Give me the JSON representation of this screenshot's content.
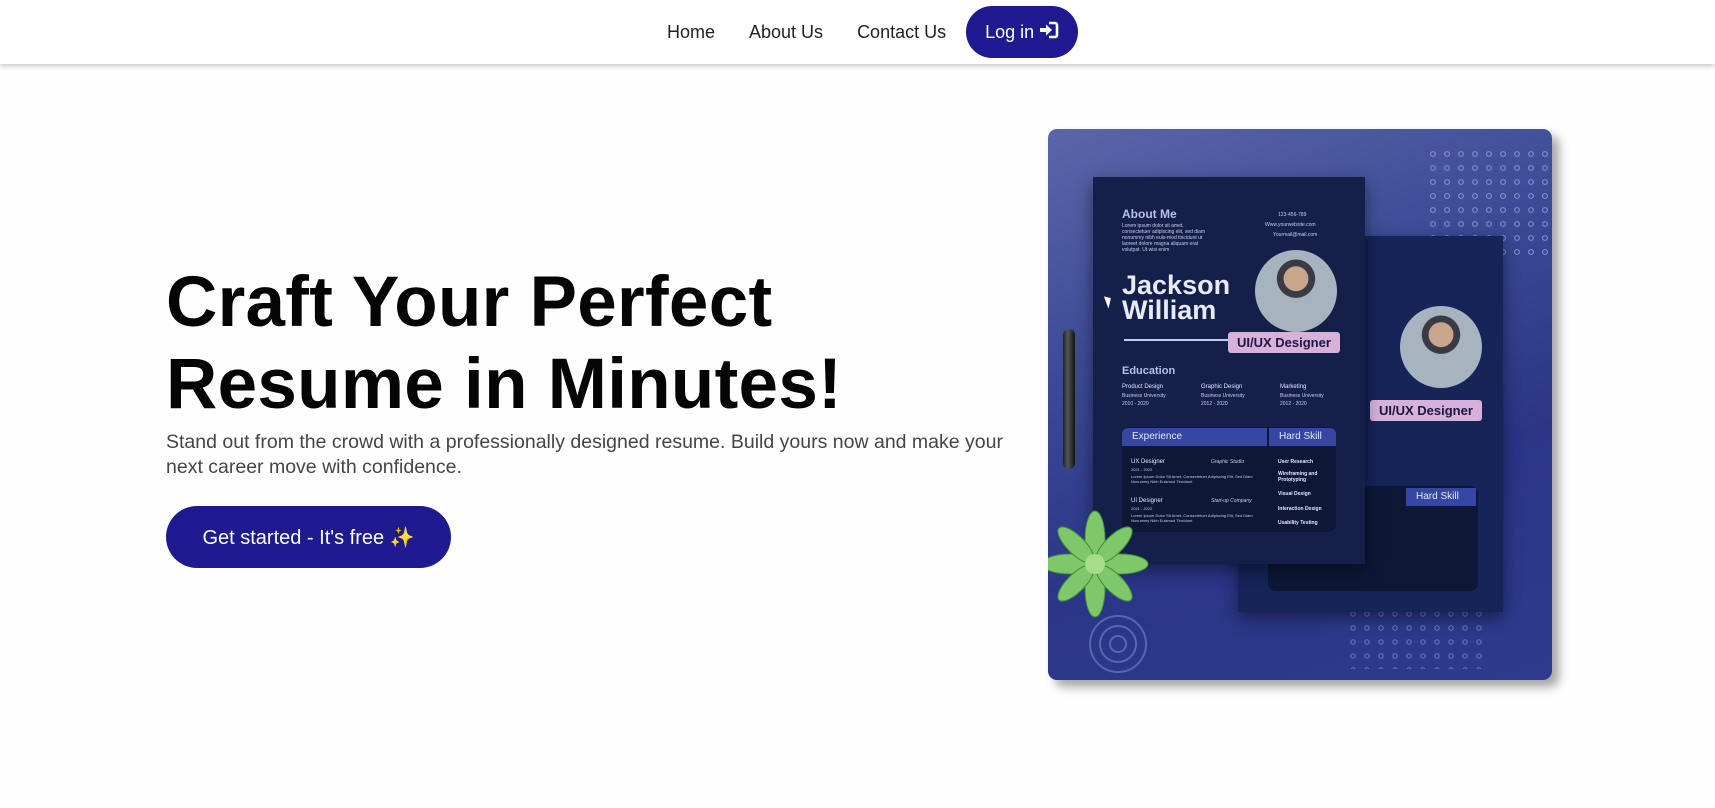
{
  "nav": {
    "items": [
      "Home",
      "About Us",
      "Contact Us"
    ],
    "login_label": "Log in",
    "login_icon": "sign-in-icon"
  },
  "hero": {
    "title": "Craft Your Perfect Resume in Minutes!",
    "subtitle": "Stand out from the crowd with a professionally designed resume. Build yours now and make your next career move with confidence.",
    "cta_label": "Get started - It's free ✨"
  },
  "resume_image": {
    "about_heading": "About Me",
    "about_text": "Lorem ipsum dolor sit amet, consectetuer adipiscing elit, sed diam nonummy nibh euis-mod tincidunt ut laoreet dolore magna aliquam erat volutpat. Ut wisi enim",
    "contact": [
      "123-456-789",
      "Www.yourwebsite.com",
      "Yourmail@mail.com"
    ],
    "first_name": "Jackson",
    "last_name": "William",
    "role": "UI/UX Designer",
    "education_heading": "Education",
    "education": [
      {
        "field": "Product Design",
        "school": "Business University",
        "years": "2010 - 2020"
      },
      {
        "field": "Graphic Design",
        "school": "Business University",
        "years": "2012 - 2020"
      },
      {
        "field": "Marketing",
        "school": "Business University",
        "years": "2012 - 2020"
      }
    ],
    "experience_heading": "Experience",
    "experience": [
      {
        "title": "UX Designer",
        "company": "Graphic Studio",
        "years": "2021 - 2022",
        "desc": "Lorem Ipsum Dolor Sit Amet, Consectetuer Adipiscing Elit, Sed Diam Nonummy Nibh Euismod Tincidunt"
      },
      {
        "title": "UI Designer",
        "company": "Start-up Company",
        "years": "2021 - 2022",
        "desc": "Lorem Ipsum Dolor Sit Amet, Consectetuer Adipiscing Elit, Sed Diam Nonummy Nibh Euismod Tincidunt"
      }
    ],
    "skill_heading": "Hard Skill",
    "skills": [
      "User Research",
      "Wireframing and Prototyping",
      "Visual Design",
      "Interaction Design",
      "Usability Testing"
    ]
  },
  "colors": {
    "accent": "#1f1a8f",
    "card_bg": "#3a4a96",
    "role_tag": "#d7b1d8"
  }
}
